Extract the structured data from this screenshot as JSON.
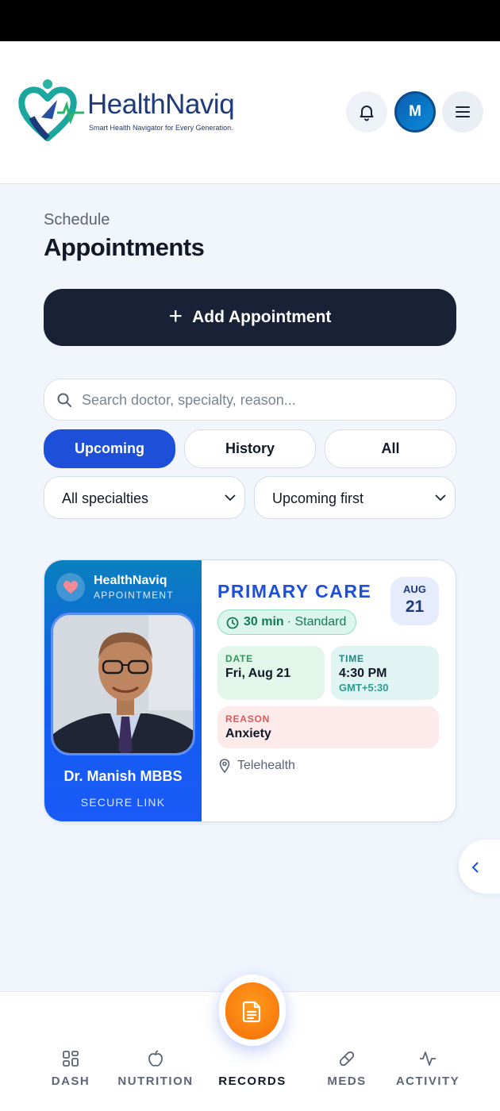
{
  "header": {
    "brand": "HealthNaviq",
    "tagline": "Smart Health Navigator for Every Generation.",
    "avatar_initial": "M"
  },
  "page": {
    "eyebrow": "Schedule",
    "title": "Appointments"
  },
  "add_button": {
    "label": "Add Appointment"
  },
  "search": {
    "placeholder": "Search doctor, specialty, reason..."
  },
  "tabs": [
    {
      "label": "Upcoming",
      "active": true
    },
    {
      "label": "History",
      "active": false
    },
    {
      "label": "All",
      "active": false
    }
  ],
  "filters": {
    "specialty": "All specialties",
    "sort": "Upcoming first"
  },
  "appointment": {
    "brand": "HealthNaviq",
    "brand_sub": "APPOINTMENT",
    "doctor": "Dr. Manish MBBS",
    "link_label": "SECURE LINK",
    "specialty": "PRIMARY CARE",
    "month": "AUG",
    "day": "21",
    "duration": "30 min",
    "type": "· Standard",
    "date_label": "DATE",
    "date_value": "Fri, Aug 21",
    "time_label": "TIME",
    "time_value": "4:30 PM",
    "timezone": "GMT+5:30",
    "reason_label": "REASON",
    "reason_value": "Anxiety",
    "location": "Telehealth"
  },
  "nav": [
    {
      "label": "DASH",
      "icon": "grid-icon"
    },
    {
      "label": "NUTRITION",
      "icon": "apple-icon"
    },
    {
      "label": "RECORDS",
      "icon": "document-icon",
      "active": true
    },
    {
      "label": "MEDS",
      "icon": "pill-icon"
    },
    {
      "label": "ACTIVITY",
      "icon": "pulse-icon"
    }
  ],
  "colors": {
    "primary": "#1d4fd8",
    "dark_button": "#182136",
    "fab": "#f57c0a",
    "background": "#f1f6fd"
  }
}
